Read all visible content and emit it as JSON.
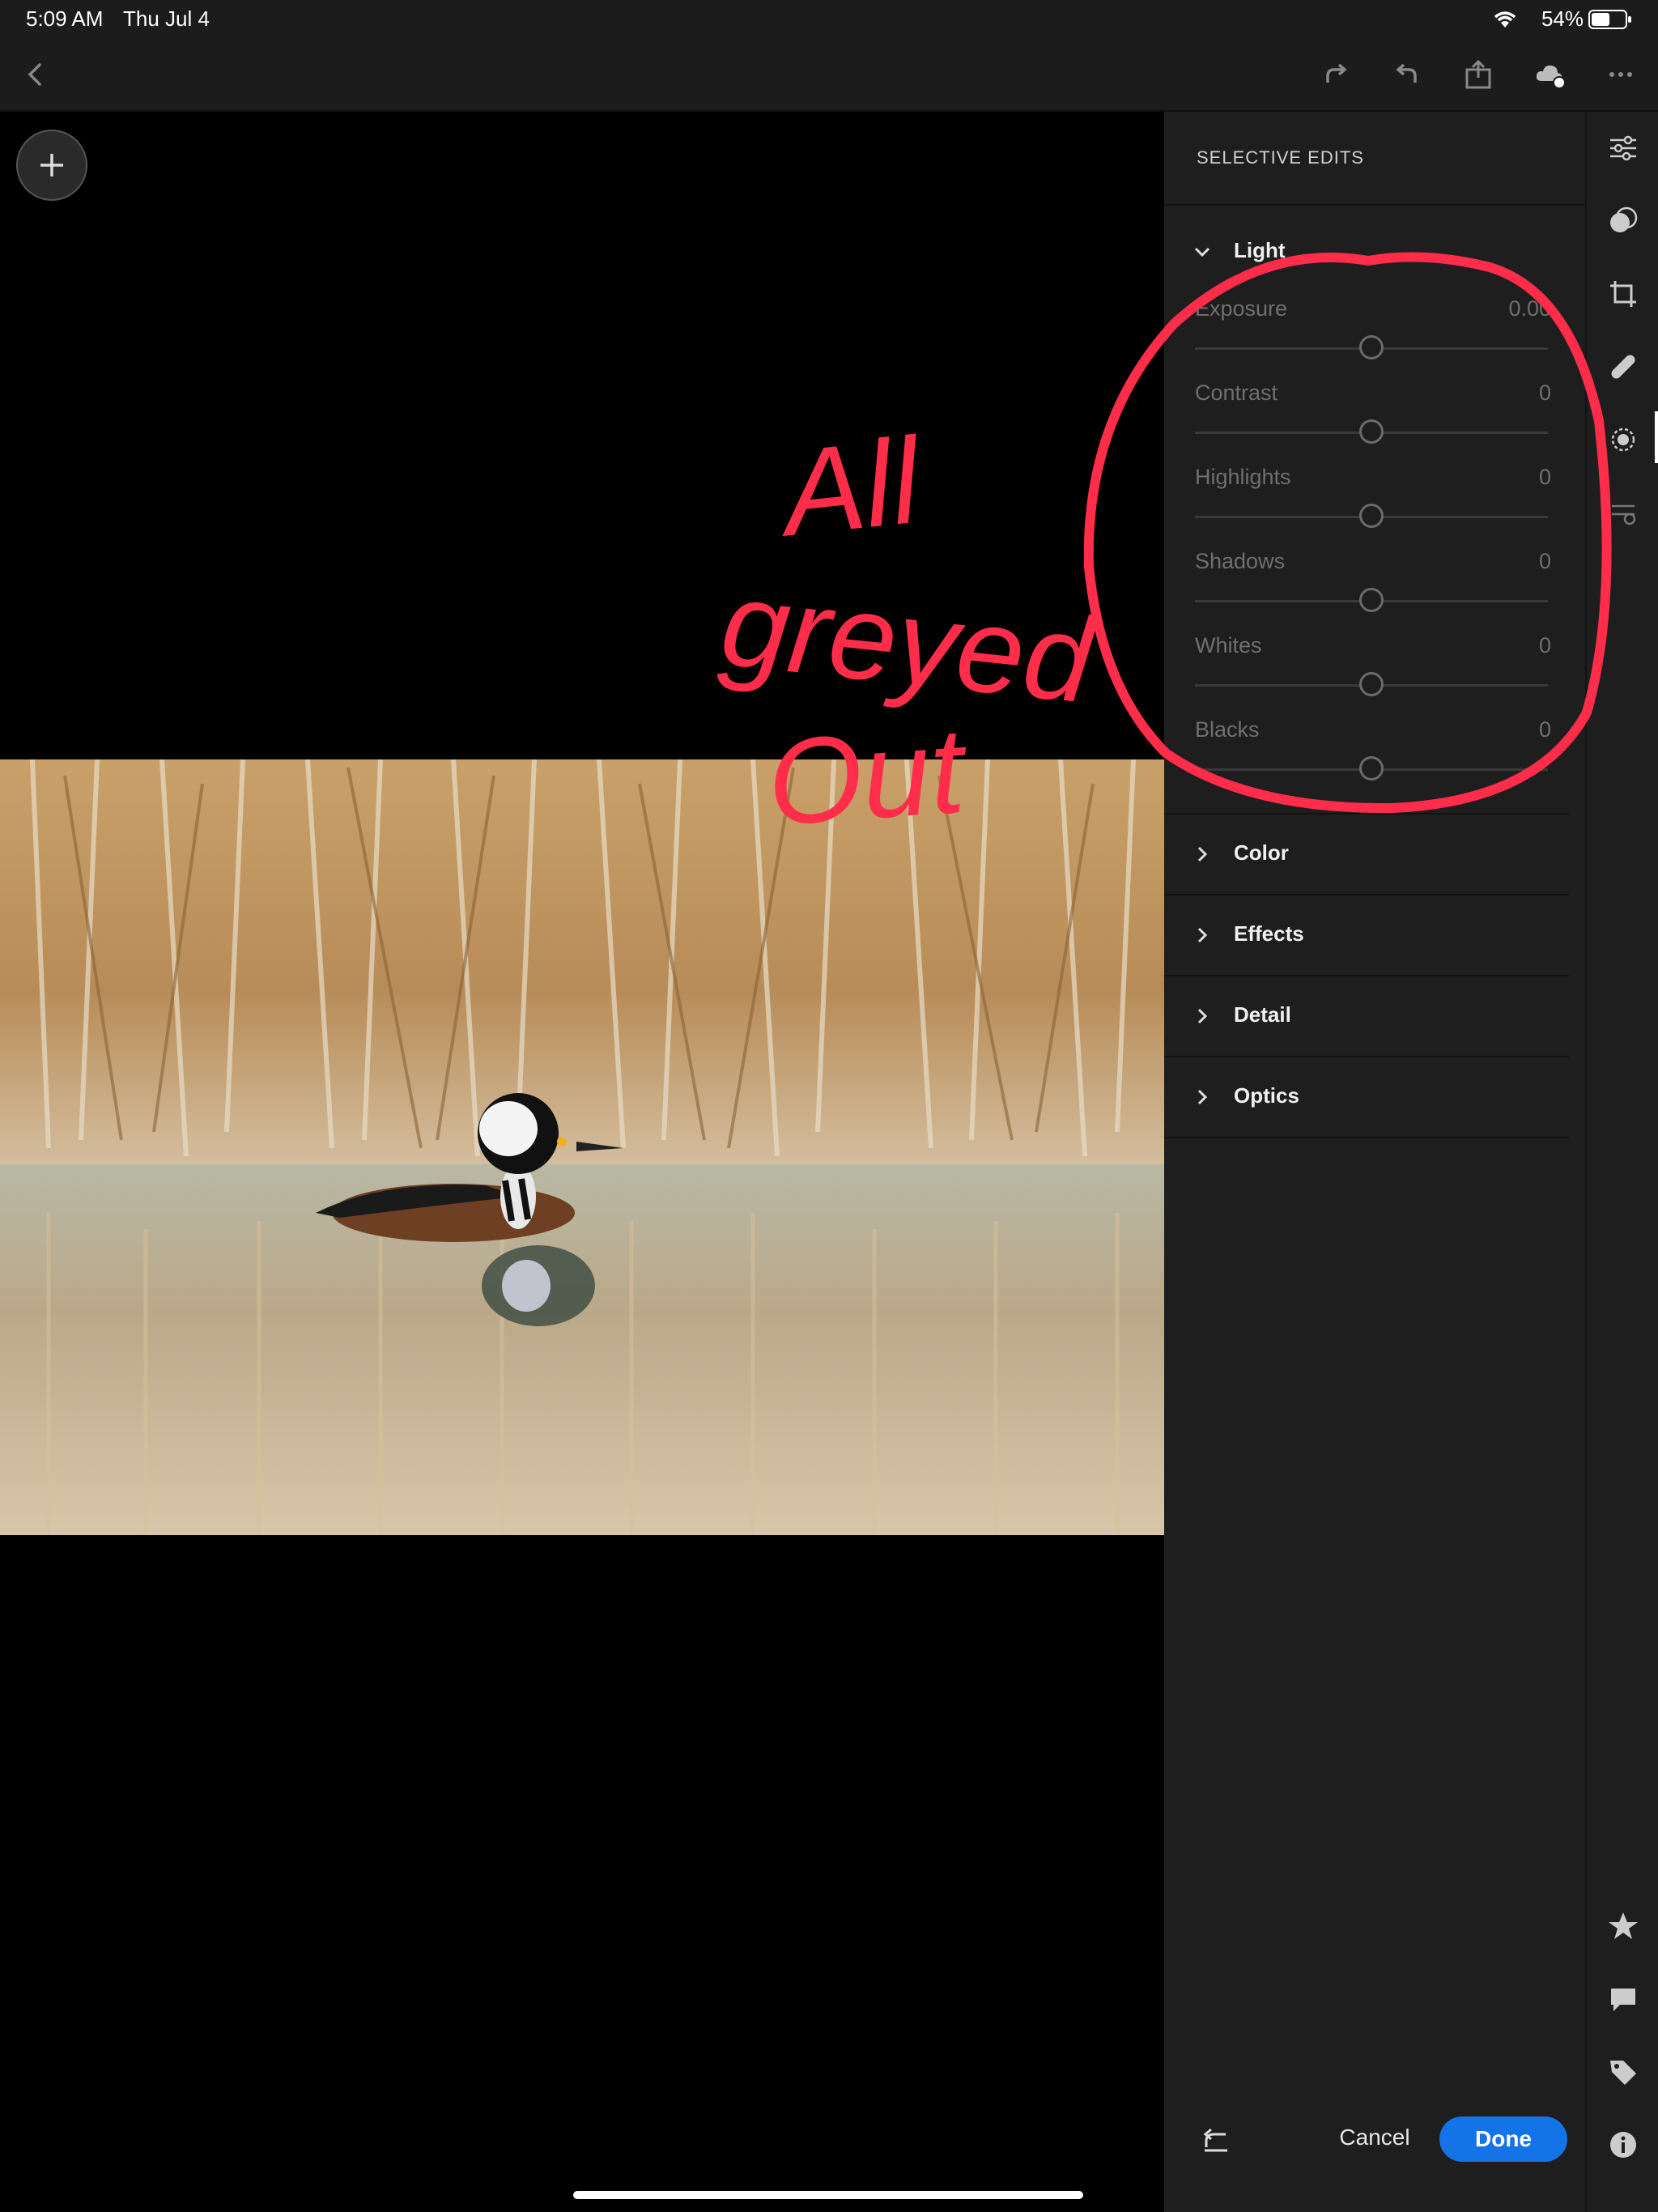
{
  "status_bar": {
    "time": "5:09 AM",
    "date": "Thu Jul 4",
    "battery_percent": "54%"
  },
  "toolbar": {
    "back_icon": "chevron-left-icon",
    "redo_icon": "redo-icon",
    "undo_icon": "undo-icon",
    "share_icon": "share-icon",
    "cloud_icon": "cloud-sync-icon",
    "more_icon": "more-icon"
  },
  "panel": {
    "header": "SELECTIVE EDITS",
    "sections": [
      {
        "title": "Light",
        "expanded": true
      },
      {
        "title": "Color",
        "expanded": false
      },
      {
        "title": "Effects",
        "expanded": false
      },
      {
        "title": "Detail",
        "expanded": false
      },
      {
        "title": "Optics",
        "expanded": false
      }
    ],
    "light_sliders": [
      {
        "label": "Exposure",
        "value": "0.00",
        "position": 0.5
      },
      {
        "label": "Contrast",
        "value": "0",
        "position": 0.5
      },
      {
        "label": "Highlights",
        "value": "0",
        "position": 0.5
      },
      {
        "label": "Shadows",
        "value": "0",
        "position": 0.5
      },
      {
        "label": "Whites",
        "value": "0",
        "position": 0.5
      },
      {
        "label": "Blacks",
        "value": "0",
        "position": 0.5
      }
    ]
  },
  "buttons": {
    "cancel": "Cancel",
    "done": "Done"
  },
  "annotation": {
    "text_line1": "All",
    "text_line2": "greyed",
    "text_line3": "Out",
    "color": "#ff2d4a"
  },
  "colors": {
    "accent": "#1473e6",
    "panel_bg": "#1e1e1e",
    "disabled_text": "#6f6f6f"
  }
}
